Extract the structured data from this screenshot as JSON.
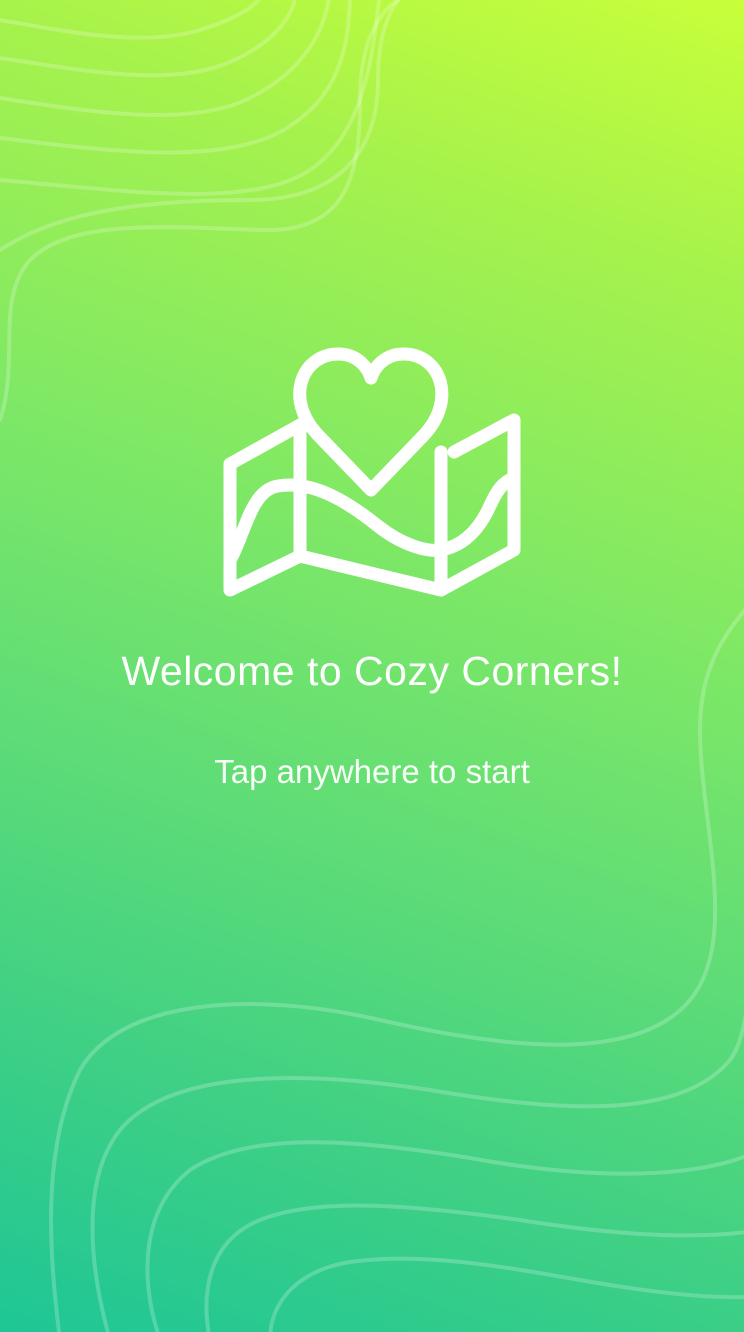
{
  "app": {
    "name": "Cozy Corners"
  },
  "welcome": {
    "title": "Welcome to Cozy Corners!",
    "prompt": "Tap anywhere to start"
  },
  "logo": {
    "icon": "map-heart-icon"
  },
  "colors": {
    "gradient_top": "#c8ff3a",
    "gradient_bottom": "#1ec696",
    "foreground": "#ffffff"
  }
}
